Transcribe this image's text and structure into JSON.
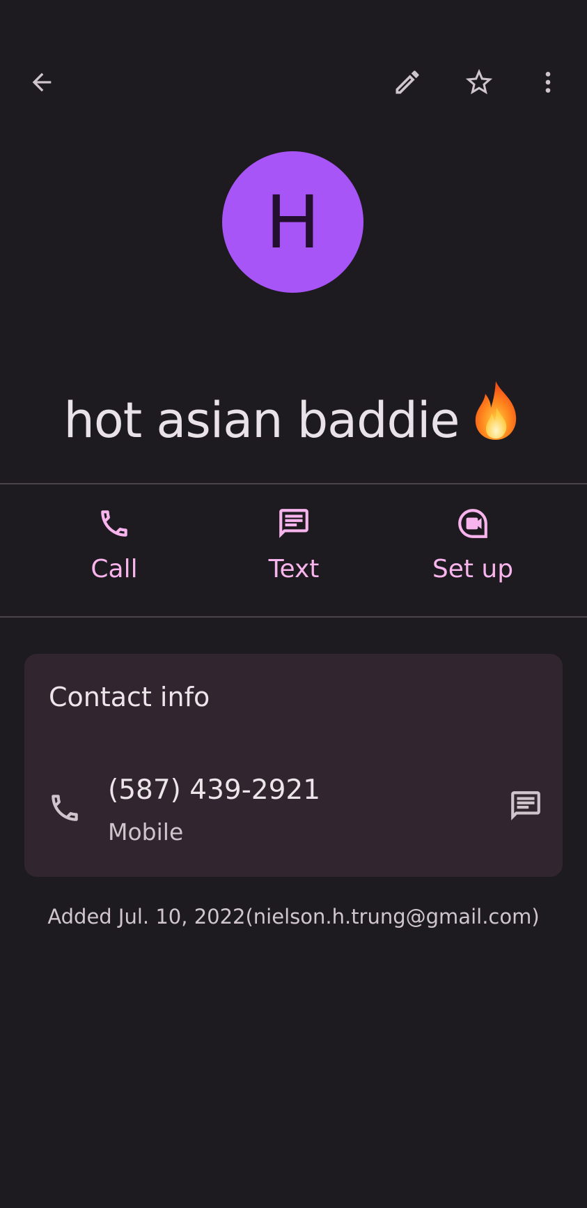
{
  "colors": {
    "background": "#1e1b20",
    "avatar": "#a855f7",
    "accent": "#f8b4ec",
    "card": "#31262f",
    "divider": "#48444a",
    "text_primary": "#e9e3e7",
    "text_secondary": "#d0c6cd"
  },
  "toolbar": {
    "back_icon": "arrow-back-icon",
    "edit_icon": "pencil-icon",
    "favorite_icon": "star-outline-icon",
    "more_icon": "more-vert-icon"
  },
  "contact": {
    "initial": "H",
    "name": "hot asian baddie",
    "name_emoji": "fire-emoji"
  },
  "actions": {
    "call": {
      "label": "Call",
      "icon": "phone-icon"
    },
    "text": {
      "label": "Text",
      "icon": "message-icon"
    },
    "setup": {
      "label": "Set up",
      "icon": "video-call-icon"
    }
  },
  "contact_info": {
    "title": "Contact info",
    "phone": {
      "number": "(587) 439-2921",
      "type": "Mobile",
      "icon": "phone-icon",
      "action_icon": "message-icon"
    }
  },
  "footer": {
    "added_text": "Added Jul. 10, 2022(nielson.h.trung@gmail.com)"
  }
}
